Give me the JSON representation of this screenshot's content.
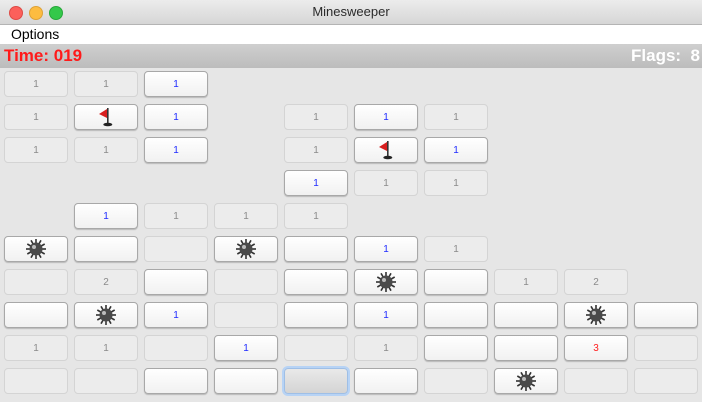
{
  "window": {
    "title": "Minesweeper"
  },
  "menu": {
    "options_label": "Options"
  },
  "status": {
    "time_text": "Time: 019",
    "flags_text": "Flags:  8"
  },
  "colors": {
    "time": "#ff1a1a",
    "flags": "#ffffff",
    "number_1": "#1f2bff",
    "number_3": "#ff2020",
    "number_dim": "#8a8a8a"
  },
  "board": {
    "rows": 10,
    "cols": 10,
    "cells": [
      [
        [
          "flat",
          "1"
        ],
        [
          "flat",
          "1"
        ],
        [
          "raised",
          "1"
        ],
        [
          "none",
          ""
        ],
        [
          "none",
          ""
        ],
        [
          "none",
          ""
        ],
        [
          "none",
          ""
        ],
        [
          "none",
          ""
        ],
        [
          "none",
          ""
        ],
        [
          "none",
          ""
        ]
      ],
      [
        [
          "flat",
          "1"
        ],
        [
          "raised",
          "flag"
        ],
        [
          "raised",
          "1"
        ],
        [
          "none",
          ""
        ],
        [
          "flat",
          "1"
        ],
        [
          "raised",
          "1"
        ],
        [
          "flat",
          "1"
        ],
        [
          "none",
          ""
        ],
        [
          "none",
          ""
        ],
        [
          "none",
          ""
        ]
      ],
      [
        [
          "flat",
          "1"
        ],
        [
          "flat",
          "1"
        ],
        [
          "raised",
          "1"
        ],
        [
          "none",
          ""
        ],
        [
          "flat",
          "1"
        ],
        [
          "raised",
          "flag"
        ],
        [
          "raised",
          "1"
        ],
        [
          "none",
          ""
        ],
        [
          "none",
          ""
        ],
        [
          "none",
          ""
        ]
      ],
      [
        [
          "none",
          ""
        ],
        [
          "none",
          ""
        ],
        [
          "none",
          ""
        ],
        [
          "none",
          ""
        ],
        [
          "raised",
          "1"
        ],
        [
          "flat",
          "1"
        ],
        [
          "flat",
          "1"
        ],
        [
          "none",
          ""
        ],
        [
          "none",
          ""
        ],
        [
          "none",
          ""
        ]
      ],
      [
        [
          "none",
          ""
        ],
        [
          "raised",
          "1"
        ],
        [
          "flat",
          "1"
        ],
        [
          "flat",
          "1"
        ],
        [
          "flat",
          "1"
        ],
        [
          "none",
          ""
        ],
        [
          "none",
          ""
        ],
        [
          "none",
          ""
        ],
        [
          "none",
          ""
        ],
        [
          "none",
          ""
        ]
      ],
      [
        [
          "raised",
          "mine"
        ],
        [
          "raised",
          ""
        ],
        [
          "flat",
          ""
        ],
        [
          "raised",
          "mine"
        ],
        [
          "raised",
          ""
        ],
        [
          "raised",
          "1"
        ],
        [
          "flat",
          "1"
        ],
        [
          "none",
          ""
        ],
        [
          "none",
          ""
        ],
        [
          "none",
          ""
        ]
      ],
      [
        [
          "flat",
          ""
        ],
        [
          "flat",
          "2"
        ],
        [
          "raised",
          ""
        ],
        [
          "flat",
          ""
        ],
        [
          "raised",
          ""
        ],
        [
          "raised",
          "mine"
        ],
        [
          "raised",
          ""
        ],
        [
          "flat",
          "1"
        ],
        [
          "flat",
          "2"
        ],
        [
          "none",
          ""
        ]
      ],
      [
        [
          "raised",
          ""
        ],
        [
          "raised",
          "mine"
        ],
        [
          "raised",
          "1"
        ],
        [
          "flat",
          ""
        ],
        [
          "raised",
          ""
        ],
        [
          "raised",
          "1"
        ],
        [
          "raised",
          ""
        ],
        [
          "raised",
          ""
        ],
        [
          "raised",
          "mine"
        ],
        [
          "raised",
          ""
        ]
      ],
      [
        [
          "flat",
          "1"
        ],
        [
          "flat",
          "1"
        ],
        [
          "flat",
          ""
        ],
        [
          "raised",
          "1"
        ],
        [
          "flat",
          ""
        ],
        [
          "flat",
          "1"
        ],
        [
          "raised",
          ""
        ],
        [
          "raised",
          ""
        ],
        [
          "raised",
          "3"
        ],
        [
          "flat",
          ""
        ]
      ],
      [
        [
          "flat",
          ""
        ],
        [
          "flat",
          ""
        ],
        [
          "raised",
          ""
        ],
        [
          "raised",
          ""
        ],
        [
          "focus",
          ""
        ],
        [
          "raised",
          ""
        ],
        [
          "flat",
          ""
        ],
        [
          "raised",
          "mine"
        ],
        [
          "flat",
          ""
        ],
        [
          "flat",
          ""
        ]
      ]
    ]
  }
}
